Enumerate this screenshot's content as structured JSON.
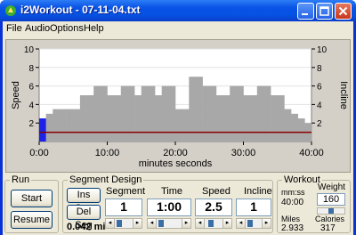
{
  "window": {
    "title": "i2Workout - 07-11-04.txt"
  },
  "menu": [
    "File",
    "Audio",
    "Options",
    "Help"
  ],
  "chart_data": {
    "type": "bar",
    "title": "",
    "xlabel": "minutes seconds",
    "ylabel_left": "Speed",
    "ylabel_right": "Incline",
    "x_ticks": [
      "0:00",
      "10:00",
      "20:00",
      "30:00",
      "40:00"
    ],
    "y_ticks": [
      2,
      4,
      6,
      8,
      10
    ],
    "ylim": [
      0,
      10
    ],
    "xlim_minutes": [
      0,
      40
    ],
    "series": [
      {
        "name": "Speed",
        "values": [
          2.5,
          3,
          3.5,
          3.5,
          3.5,
          3.5,
          5,
          5,
          6,
          6,
          5,
          5,
          6,
          6,
          5,
          6,
          6,
          5,
          6,
          6,
          3.5,
          3.5,
          7,
          7,
          6,
          6,
          5,
          5,
          6,
          6,
          5,
          5,
          6,
          6,
          5,
          5,
          3.5,
          3,
          2.5,
          2
        ]
      },
      {
        "name": "Incline",
        "values": [
          1,
          1,
          1,
          1,
          1,
          1,
          1,
          1,
          1,
          1,
          1,
          1,
          1,
          1,
          1,
          1,
          1,
          1,
          1,
          1,
          1,
          1,
          1,
          1,
          1,
          1,
          1,
          1,
          1,
          1,
          1,
          1,
          1,
          1,
          1,
          1,
          1,
          1,
          1,
          1
        ]
      }
    ],
    "selected_segment": 1,
    "colors": {
      "bars": "#a8a8a8",
      "selected": "#1c22e6",
      "incline": "#8b0000"
    }
  },
  "run": {
    "label": "Run",
    "start": "Start",
    "resume": "Resume"
  },
  "segment_design": {
    "label": "Segment Design",
    "ins_seg": "Ins Seg",
    "del_seg": "Del Seg",
    "distance": "0.042 mi",
    "segment_label": "Segment",
    "segment_value": "1",
    "time_label": "Time",
    "time_value": "1:00",
    "speed_label": "Speed",
    "speed_value": "2.5",
    "incline_label": "Incline",
    "incline_value": "1"
  },
  "workout": {
    "label": "Workout",
    "mmss_label": "mm:ss",
    "mmss_value": "40:00",
    "weight_label": "Weight",
    "weight_value": "160",
    "miles_label": "Miles",
    "miles_value": "2.933",
    "calories_label": "Calories",
    "calories_value": "317"
  }
}
